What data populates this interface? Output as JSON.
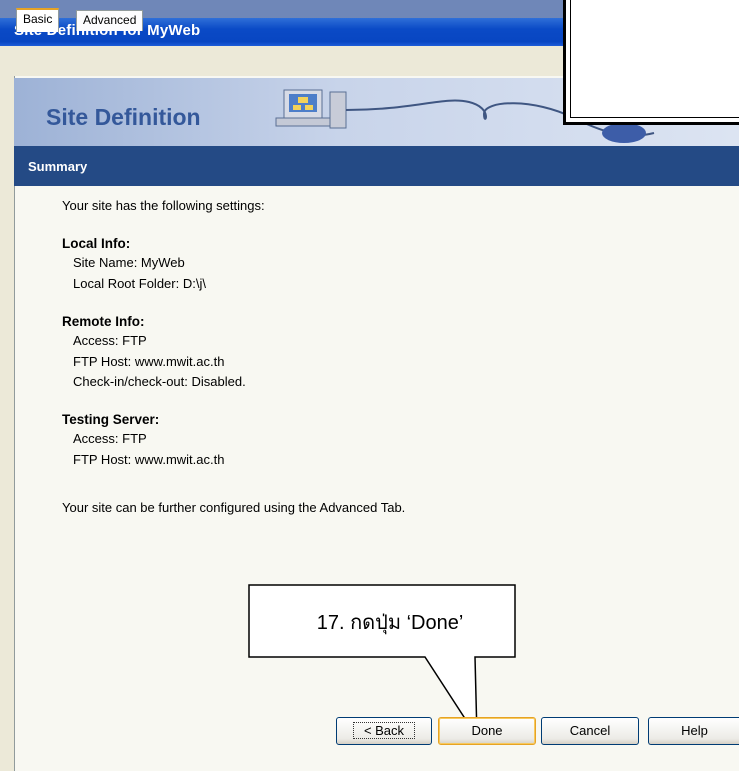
{
  "window": {
    "title": "Site Definition for MyWeb"
  },
  "tabs": [
    {
      "label": "Basic",
      "active": true
    },
    {
      "label": "Advanced",
      "active": false
    }
  ],
  "banner": {
    "title": "Site Definition"
  },
  "section": {
    "title": "Summary"
  },
  "summary": {
    "intro": "Your site has the following settings:",
    "local": {
      "heading": "Local Info:",
      "site_name": "Site Name: MyWeb",
      "root_folder": "Local Root Folder: D:\\j\\"
    },
    "remote": {
      "heading": "Remote Info:",
      "access": "Access: FTP",
      "host": "FTP Host: www.mwit.ac.th",
      "checkin": "Check-in/check-out: Disabled."
    },
    "testing": {
      "heading": "Testing Server:",
      "access": "Access: FTP",
      "host": "FTP Host: www.mwit.ac.th"
    },
    "footer": "Your site can be further configured using the Advanced Tab."
  },
  "buttons": {
    "back": "< Back",
    "done": "Done",
    "cancel": "Cancel",
    "help": "Help"
  },
  "callout": {
    "text": "17. กดปุ่ม ‘Done’"
  },
  "colors": {
    "titlebar": "#0846c2",
    "section_bar": "#244a85",
    "banner_text": "#34589a",
    "accent": "#e6a325"
  }
}
